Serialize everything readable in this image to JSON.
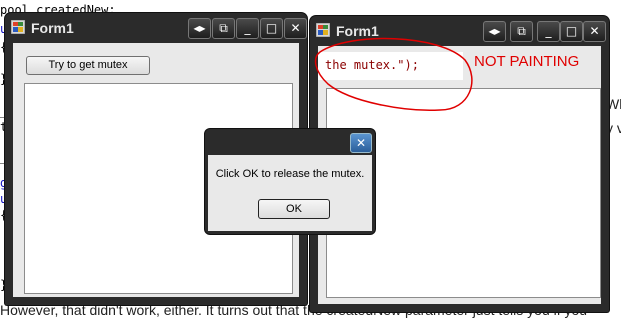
{
  "background": {
    "code_lines": [
      "pool createdNew;",
      "us",
      "{",
      "}",
      "_Lo",
      "tv",
      "_e",
      "go",
      "us",
      "{",
      "}"
    ],
    "code_right": [
      "Wh",
      "y v"
    ],
    "prose": "However, that didn't work, either. It turns out that the createdNew parameter just tells you if you"
  },
  "window_left": {
    "title": "Form1",
    "button_label": "Try to get mutex"
  },
  "window_right": {
    "title": "Form1",
    "code_snippet": "the mutex.\");",
    "annotation": "NOT PAINTING"
  },
  "dialog": {
    "message": "Click OK to release the mutex.",
    "ok_label": "OK"
  },
  "titlebar_buttons": {
    "arrows": "◂▸",
    "restore": "⧉",
    "minimize": "_",
    "maximize": "□",
    "close": "✕"
  },
  "colors": {
    "annotation_red": "#e00000",
    "dialog_close_blue": "#3a76b8"
  }
}
